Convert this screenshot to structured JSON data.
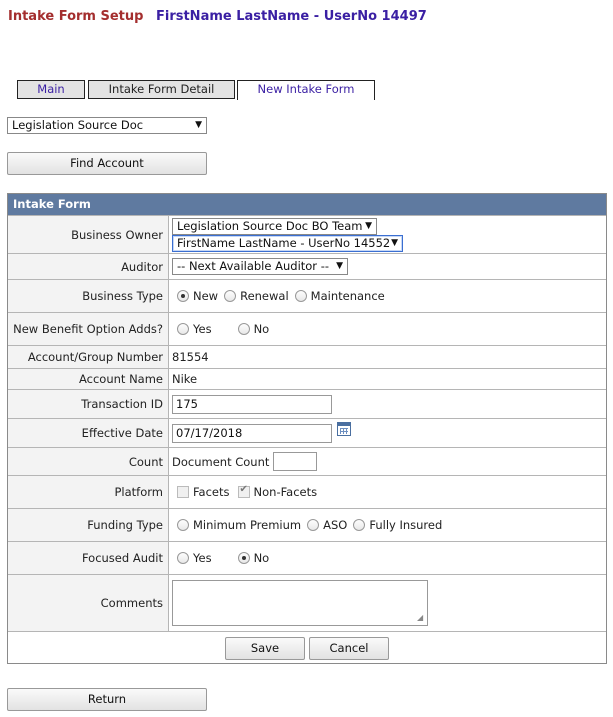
{
  "header": {
    "title": "Intake Form Setup",
    "user": "FirstName LastName - UserNo 14497"
  },
  "tabs": [
    {
      "label": "Main"
    },
    {
      "label": "Intake Form Detail"
    },
    {
      "label": "New Intake Form"
    }
  ],
  "doc_type_select": {
    "value": "Legislation Source Doc"
  },
  "find_account_button": "Find Account",
  "form": {
    "title": "Intake Form",
    "business_owner": {
      "label": "Business Owner",
      "team_value": "Legislation Source Doc BO Team",
      "user_value": "FirstName LastName - UserNo 14552"
    },
    "auditor": {
      "label": "Auditor",
      "value": "-- Next Available Auditor --"
    },
    "business_type": {
      "label": "Business Type",
      "options": [
        "New",
        "Renewal",
        "Maintenance"
      ],
      "selected": "New"
    },
    "new_benefit": {
      "label": "New Benefit Option Adds?",
      "options": [
        "Yes",
        "No"
      ],
      "selected": ""
    },
    "account_group_number": {
      "label": "Account/Group Number",
      "value": "81554"
    },
    "account_name": {
      "label": "Account Name",
      "value": "Nike"
    },
    "transaction_id": {
      "label": "Transaction ID",
      "value": "175"
    },
    "effective_date": {
      "label": "Effective Date",
      "value": "07/17/2018"
    },
    "count": {
      "label": "Count",
      "sub_label": "Document Count",
      "value": ""
    },
    "platform": {
      "label": "Platform",
      "options": [
        {
          "label": "Facets",
          "checked": false
        },
        {
          "label": "Non-Facets",
          "checked": true
        }
      ]
    },
    "funding_type": {
      "label": "Funding Type",
      "options": [
        "Minimum Premium",
        "ASO",
        "Fully Insured"
      ],
      "selected": ""
    },
    "focused_audit": {
      "label": "Focused Audit",
      "options": [
        "Yes",
        "No"
      ],
      "selected": "No"
    },
    "comments": {
      "label": "Comments",
      "value": ""
    },
    "save_label": "Save",
    "cancel_label": "Cancel"
  },
  "return_button": "Return",
  "colors": {
    "title_red": "#a42e2e",
    "user_purple": "#3a1fa3",
    "form_header": "#5f7aa0"
  }
}
